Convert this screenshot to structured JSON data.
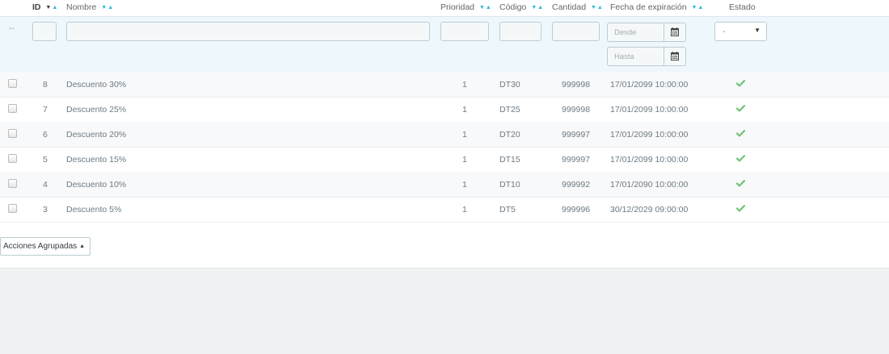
{
  "columns": {
    "id": "ID",
    "name": "Nombre",
    "priority": "Prioridad",
    "code": "Código",
    "quantity": "Cantidad",
    "expiry": "Fecha de expiración",
    "status": "Estado"
  },
  "sort_glyphs": {
    "down": "▼",
    "up": "▲"
  },
  "filters": {
    "dash": "--",
    "date_from_placeholder": "Desde",
    "date_to_placeholder": "Hasta",
    "status_selected": "-",
    "select_caret": "▼"
  },
  "rows": [
    {
      "id": "8",
      "name": "Descuento 30%",
      "priority": "1",
      "code": "DT30",
      "quantity": "999998",
      "expiry": "17/01/2099 10:00:00"
    },
    {
      "id": "7",
      "name": "Descuento 25%",
      "priority": "1",
      "code": "DT25",
      "quantity": "999998",
      "expiry": "17/01/2099 10:00:00"
    },
    {
      "id": "6",
      "name": "Descuento 20%",
      "priority": "1",
      "code": "DT20",
      "quantity": "999997",
      "expiry": "17/01/2099 10:00:00"
    },
    {
      "id": "5",
      "name": "Descuento 15%",
      "priority": "1",
      "code": "DT15",
      "quantity": "999997",
      "expiry": "17/01/2099 10:00:00"
    },
    {
      "id": "4",
      "name": "Descuento 10%",
      "priority": "1",
      "code": "DT10",
      "quantity": "999992",
      "expiry": "17/01/2090 10:00:00"
    },
    {
      "id": "3",
      "name": "Descuento 5%",
      "priority": "1",
      "code": "DT5",
      "quantity": "999996",
      "expiry": "30/12/2029 09:00:00"
    }
  ],
  "bulk_actions": {
    "label": "Acciones Agrupadas",
    "arrow": "▲"
  },
  "colors": {
    "accent": "#25b9d7",
    "status_enabled": "#72c279",
    "filter_bg": "#eef7fc"
  },
  "icons": {
    "status": "check-icon",
    "date_picker": "calendar-icon"
  }
}
